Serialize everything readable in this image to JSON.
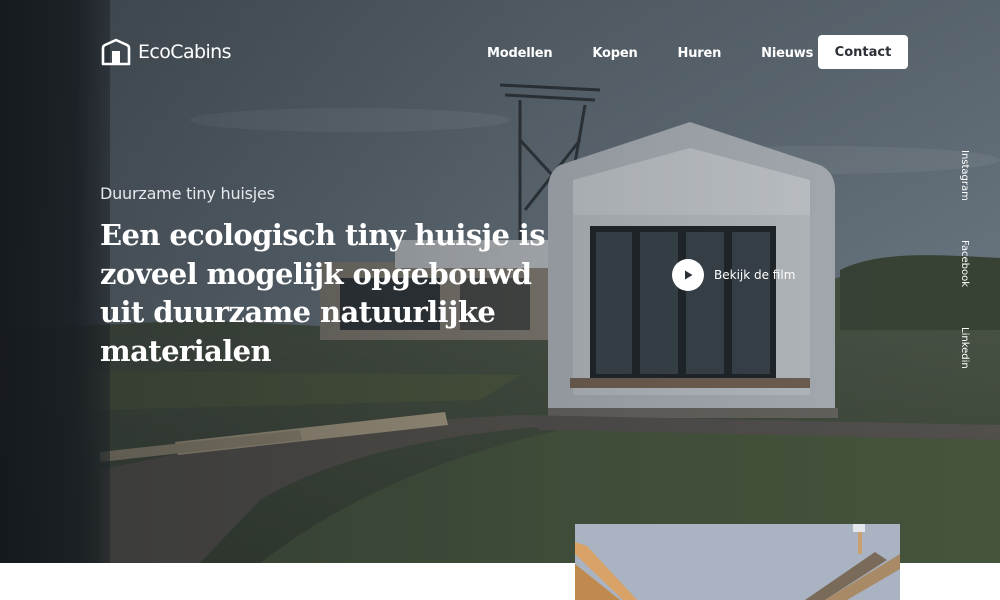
{
  "brand": {
    "name": "EcoCabins",
    "icon": "cabin-logo-icon"
  },
  "nav": {
    "items": [
      {
        "label": "Modellen"
      },
      {
        "label": "Kopen"
      },
      {
        "label": "Huren"
      },
      {
        "label": "Nieuws"
      }
    ],
    "contact_label": "Contact"
  },
  "hero": {
    "eyebrow": "Duurzame tiny huisjes",
    "headline": "Een ecologisch tiny huisje is zoveel mogelijk opgebouwd uit duurzame natuurlijke materialen",
    "film_label": "Bekijk de film",
    "play_icon": "play-icon"
  },
  "social": {
    "instagram": "Instagram",
    "facebook": "Facebook",
    "linkedin": "Linkedin"
  },
  "colors": {
    "overlay_dark": "#1c2125",
    "button_text": "#2b3036",
    "sky": "#6f7c87",
    "grass": "#3f4b38"
  }
}
